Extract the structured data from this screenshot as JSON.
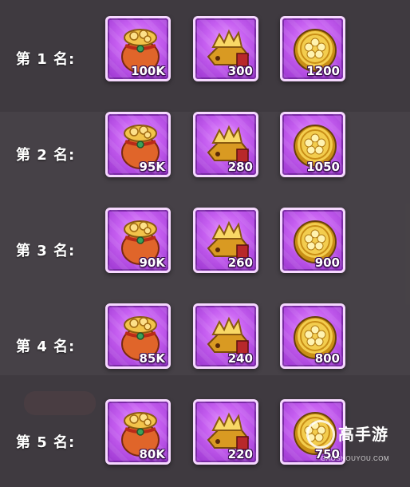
{
  "ranks": [
    {
      "label": "第 1 名:",
      "items": [
        {
          "icon": "coin-bag-icon",
          "qty": "100K"
        },
        {
          "icon": "gold-ingot-icon",
          "qty": "300"
        },
        {
          "icon": "gold-coin-icon",
          "qty": "1200"
        }
      ]
    },
    {
      "label": "第 2 名:",
      "items": [
        {
          "icon": "coin-bag-icon",
          "qty": "95K"
        },
        {
          "icon": "gold-ingot-icon",
          "qty": "280"
        },
        {
          "icon": "gold-coin-icon",
          "qty": "1050"
        }
      ]
    },
    {
      "label": "第 3 名:",
      "items": [
        {
          "icon": "coin-bag-icon",
          "qty": "90K"
        },
        {
          "icon": "gold-ingot-icon",
          "qty": "260"
        },
        {
          "icon": "gold-coin-icon",
          "qty": "900"
        }
      ]
    },
    {
      "label": "第 4 名:",
      "items": [
        {
          "icon": "coin-bag-icon",
          "qty": "85K"
        },
        {
          "icon": "gold-ingot-icon",
          "qty": "240"
        },
        {
          "icon": "gold-coin-icon",
          "qty": "800"
        }
      ]
    },
    {
      "label": "第 5 名:",
      "items": [
        {
          "icon": "coin-bag-icon",
          "qty": "80K"
        },
        {
          "icon": "gold-ingot-icon",
          "qty": "220"
        },
        {
          "icon": "gold-coin-icon",
          "qty": "750"
        }
      ]
    }
  ],
  "watermark": {
    "name": "高手游",
    "url": "GAOSHOUYOU.COM"
  },
  "colors": {
    "tile_border": "#f6d8ff",
    "tile_fill": "#c55ef0",
    "background": "#3f3a40"
  }
}
